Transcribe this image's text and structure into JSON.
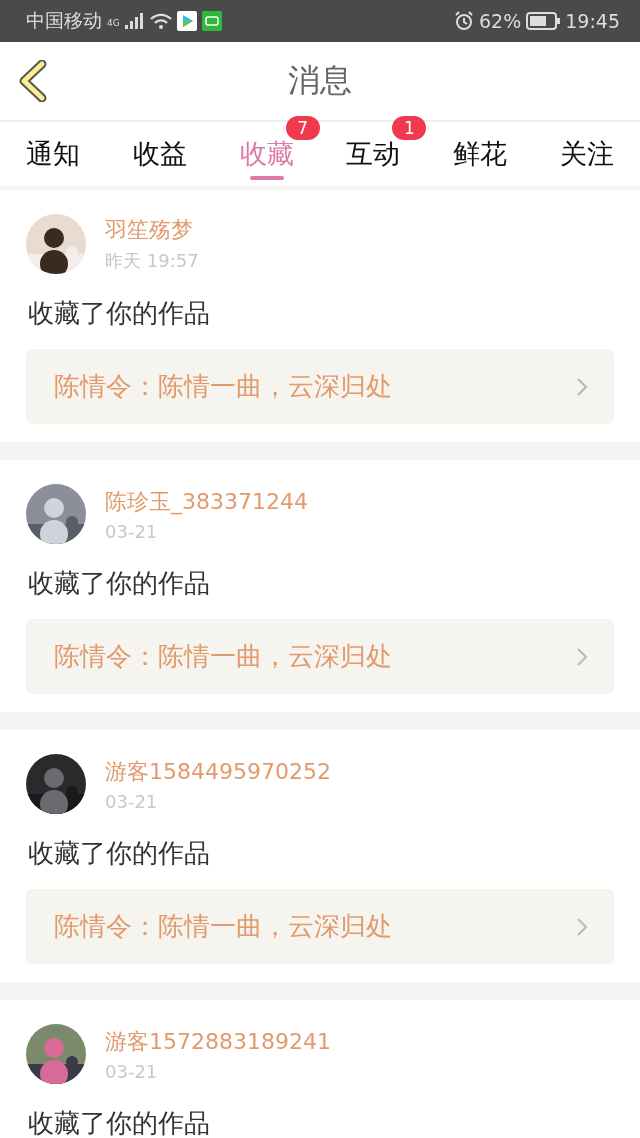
{
  "status_bar": {
    "carrier": "中国移动",
    "network": "4G",
    "battery": "62%",
    "time": "19:45"
  },
  "header": {
    "title": "消息"
  },
  "tabs": [
    {
      "label": "通知",
      "selected": false
    },
    {
      "label": "收益",
      "selected": false
    },
    {
      "label": "收藏",
      "selected": true,
      "badge": "7"
    },
    {
      "label": "互动",
      "selected": false,
      "badge": "1"
    },
    {
      "label": "鲜花",
      "selected": false
    },
    {
      "label": "关注",
      "selected": false
    }
  ],
  "messages": [
    {
      "user": "羽笙殇梦",
      "time": "昨天 19:57",
      "action": "收藏了你的作品",
      "work": "陈情令：陈情一曲，云深归处"
    },
    {
      "user": "陈珍玉_383371244",
      "time": "03-21",
      "action": "收藏了你的作品",
      "work": "陈情令：陈情一曲，云深归处"
    },
    {
      "user": "游客1584495970252",
      "time": "03-21",
      "action": "收藏了你的作品",
      "work": "陈情令：陈情一曲，云深归处"
    },
    {
      "user": "游客1572883189241",
      "time": "03-21",
      "action": "收藏了你的作品"
    }
  ]
}
